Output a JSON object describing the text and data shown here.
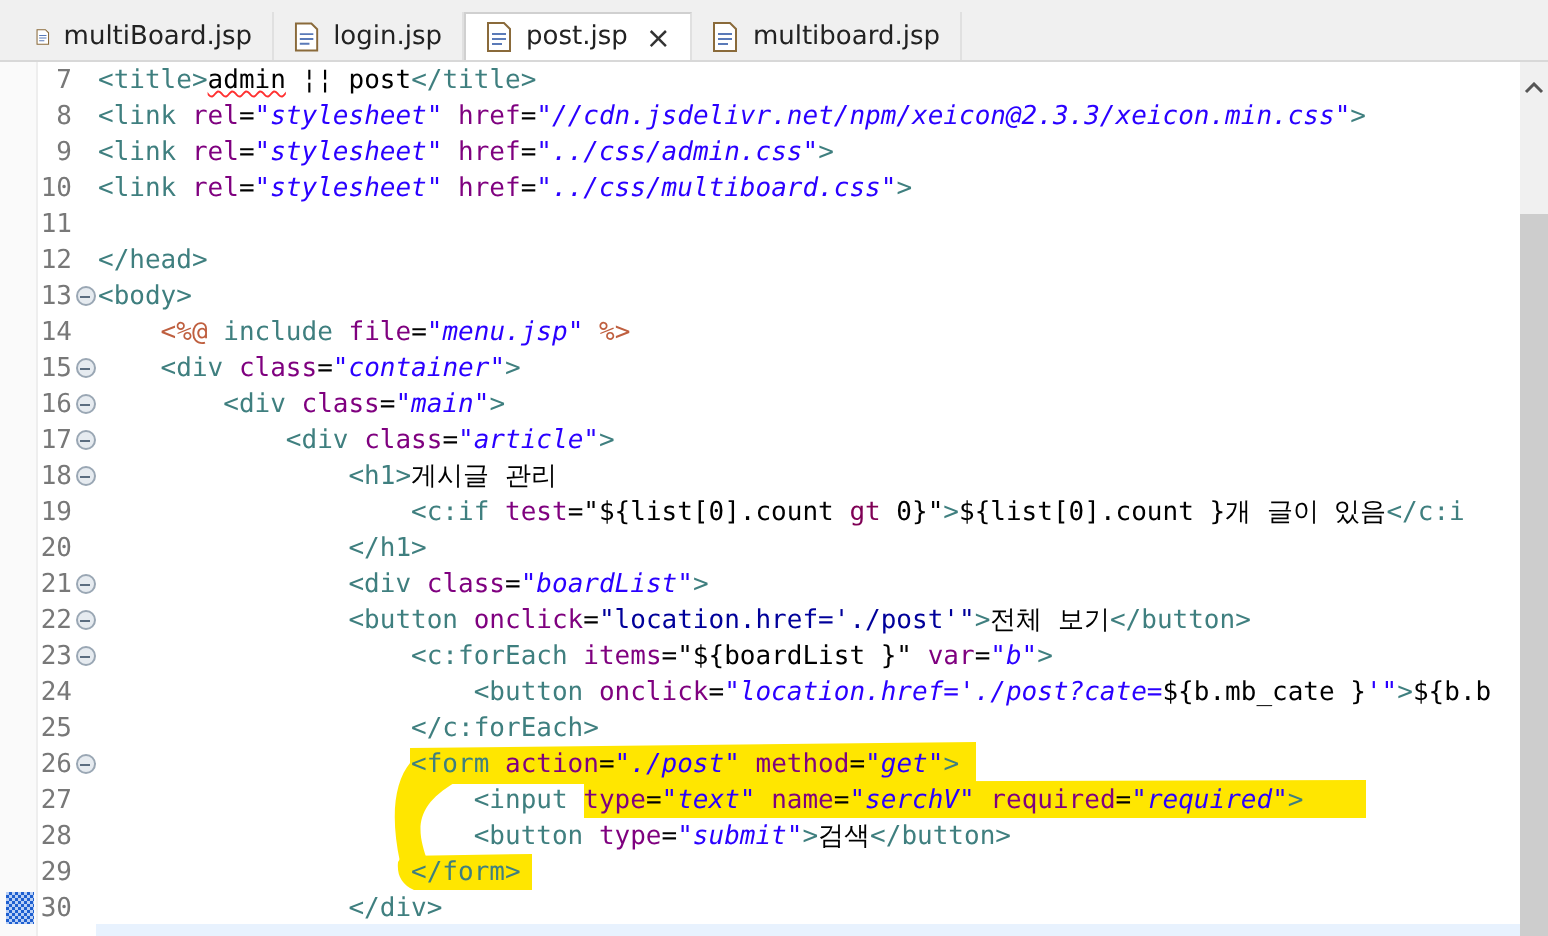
{
  "tabs": [
    {
      "label": "multiBoard.jsp",
      "selected": false
    },
    {
      "label": "login.jsp",
      "selected": false
    },
    {
      "label": "post.jsp",
      "selected": true,
      "close": "×"
    },
    {
      "label": "multiboard.jsp",
      "selected": false
    }
  ],
  "lines": [
    {
      "number": "7",
      "foldable": false,
      "changed": false,
      "tokens": [
        {
          "kind": "tag",
          "text": "<title>"
        },
        {
          "kind": "plain",
          "text": "admin",
          "spell_error": true
        },
        {
          "kind": "plain",
          "text": " ¦¦ post"
        },
        {
          "kind": "tag",
          "text": "</title>"
        }
      ]
    },
    {
      "number": "8",
      "foldable": false,
      "changed": false,
      "tokens": [
        {
          "kind": "tag",
          "text": "<link "
        },
        {
          "kind": "attr",
          "text": "rel"
        },
        {
          "kind": "plain",
          "text": "="
        },
        {
          "kind": "string",
          "text": "\"stylesheet\""
        },
        {
          "kind": "attr",
          "text": " href"
        },
        {
          "kind": "plain",
          "text": "="
        },
        {
          "kind": "string",
          "text": "\"//cdn.jsdelivr.net/npm/xeicon@2.3.3/xeicon.min.css\""
        },
        {
          "kind": "tag",
          "text": ">"
        }
      ]
    },
    {
      "number": "9",
      "foldable": false,
      "changed": false,
      "tokens": [
        {
          "kind": "tag",
          "text": "<link "
        },
        {
          "kind": "attr",
          "text": "rel"
        },
        {
          "kind": "plain",
          "text": "="
        },
        {
          "kind": "string",
          "text": "\"stylesheet\""
        },
        {
          "kind": "attr",
          "text": " href"
        },
        {
          "kind": "plain",
          "text": "="
        },
        {
          "kind": "string",
          "text": "\"../css/admin.css\""
        },
        {
          "kind": "tag",
          "text": ">"
        }
      ]
    },
    {
      "number": "10",
      "foldable": false,
      "changed": false,
      "tokens": [
        {
          "kind": "tag",
          "text": "<link "
        },
        {
          "kind": "attr",
          "text": "rel"
        },
        {
          "kind": "plain",
          "text": "="
        },
        {
          "kind": "string",
          "text": "\"stylesheet\""
        },
        {
          "kind": "attr",
          "text": " href"
        },
        {
          "kind": "plain",
          "text": "="
        },
        {
          "kind": "string",
          "text": "\"../css/multiboard.css\""
        },
        {
          "kind": "tag",
          "text": ">"
        }
      ]
    },
    {
      "number": "11",
      "foldable": false,
      "changed": false
    },
    {
      "number": "12",
      "foldable": false,
      "changed": false,
      "tokens": [
        {
          "kind": "tag",
          "text": "</head>"
        }
      ]
    },
    {
      "number": "13",
      "foldable": true,
      "changed": false,
      "tokens": [
        {
          "kind": "tag",
          "text": "<body>"
        }
      ]
    },
    {
      "number": "14",
      "foldable": false,
      "changed": false,
      "tokens": [
        {
          "kind": "jsp",
          "text": "    <%@ "
        },
        {
          "kind": "tag",
          "text": "include "
        },
        {
          "kind": "attr",
          "text": "file"
        },
        {
          "kind": "plain",
          "text": "="
        },
        {
          "kind": "string",
          "text": "\"menu.jsp\""
        },
        {
          "kind": "jsp",
          "text": " %>"
        }
      ]
    },
    {
      "number": "15",
      "foldable": true,
      "changed": false,
      "tokens": [
        {
          "kind": "tag",
          "text": "    <div "
        },
        {
          "kind": "attr",
          "text": "class"
        },
        {
          "kind": "plain",
          "text": "="
        },
        {
          "kind": "string",
          "text": "\"container\""
        },
        {
          "kind": "tag",
          "text": ">"
        }
      ]
    },
    {
      "number": "16",
      "foldable": true,
      "changed": false,
      "tokens": [
        {
          "kind": "tag",
          "text": "        <div "
        },
        {
          "kind": "attr",
          "text": "class"
        },
        {
          "kind": "plain",
          "text": "="
        },
        {
          "kind": "string",
          "text": "\"main\""
        },
        {
          "kind": "tag",
          "text": ">"
        }
      ]
    },
    {
      "number": "17",
      "foldable": true,
      "changed": false,
      "tokens": [
        {
          "kind": "tag",
          "text": "            <div "
        },
        {
          "kind": "attr",
          "text": "class"
        },
        {
          "kind": "plain",
          "text": "="
        },
        {
          "kind": "string",
          "text": "\"article\""
        },
        {
          "kind": "tag",
          "text": ">"
        }
      ]
    },
    {
      "number": "18",
      "foldable": true,
      "changed": false,
      "tokens": [
        {
          "kind": "tag",
          "text": "                <h1>"
        },
        {
          "kind": "plain",
          "text": "게시글 관리"
        }
      ]
    },
    {
      "number": "19",
      "foldable": false,
      "changed": false,
      "tokens": [
        {
          "kind": "tag",
          "text": "                    <c:if "
        },
        {
          "kind": "attr",
          "text": "test"
        },
        {
          "kind": "plain",
          "text": "=\"${list[0].count "
        },
        {
          "kind": "keyword",
          "text": "gt"
        },
        {
          "kind": "plain",
          "text": " 0}\""
        },
        {
          "kind": "tag",
          "text": ">"
        },
        {
          "kind": "plain",
          "text": "${list[0].count }개 글이 있음"
        },
        {
          "kind": "tag",
          "text": "</c:i"
        }
      ]
    },
    {
      "number": "20",
      "foldable": false,
      "changed": false,
      "tokens": [
        {
          "kind": "tag",
          "text": "                </h1>"
        }
      ]
    },
    {
      "number": "21",
      "foldable": true,
      "changed": false,
      "tokens": [
        {
          "kind": "tag",
          "text": "                <div "
        },
        {
          "kind": "attr",
          "text": "class"
        },
        {
          "kind": "plain",
          "text": "="
        },
        {
          "kind": "string",
          "text": "\"boardList\""
        },
        {
          "kind": "tag",
          "text": ">"
        }
      ]
    },
    {
      "number": "22",
      "foldable": true,
      "changed": false,
      "tokens": [
        {
          "kind": "tag",
          "text": "                <button "
        },
        {
          "kind": "attr",
          "text": "onclick"
        },
        {
          "kind": "plain",
          "text": "="
        },
        {
          "kind": "script",
          "text": "\"location.href='./post'\""
        },
        {
          "kind": "tag",
          "text": ">"
        },
        {
          "kind": "plain",
          "text": "전체 보기"
        },
        {
          "kind": "tag",
          "text": "</button>"
        }
      ]
    },
    {
      "number": "23",
      "foldable": true,
      "changed": false,
      "tokens": [
        {
          "kind": "tag",
          "text": "                    <c:forEach "
        },
        {
          "kind": "attr",
          "text": "items"
        },
        {
          "kind": "plain",
          "text": "=\"${boardList }\" "
        },
        {
          "kind": "attr",
          "text": "var"
        },
        {
          "kind": "plain",
          "text": "="
        },
        {
          "kind": "string",
          "text": "\"b\""
        },
        {
          "kind": "tag",
          "text": ">"
        }
      ]
    },
    {
      "number": "24",
      "foldable": false,
      "changed": false,
      "tokens": [
        {
          "kind": "tag",
          "text": "                        <button "
        },
        {
          "kind": "attr",
          "text": "onclick"
        },
        {
          "kind": "plain",
          "text": "="
        },
        {
          "kind": "string",
          "text": "\"location.href='./post?cate="
        },
        {
          "kind": "plain",
          "text": "${b.mb_cate }"
        },
        {
          "kind": "string",
          "text": "'\""
        },
        {
          "kind": "tag",
          "text": ">"
        },
        {
          "kind": "plain",
          "text": "${b.b"
        }
      ]
    },
    {
      "number": "25",
      "foldable": false,
      "changed": false,
      "tokens": [
        {
          "kind": "tag",
          "text": "                    </c:forEach>"
        }
      ]
    },
    {
      "number": "26",
      "foldable": true,
      "changed": false,
      "tokens": [
        {
          "kind": "tag",
          "text": "                    <form "
        },
        {
          "kind": "attr",
          "text": "action"
        },
        {
          "kind": "plain",
          "text": "="
        },
        {
          "kind": "string",
          "text": "\"./post\""
        },
        {
          "kind": "attr",
          "text": " method"
        },
        {
          "kind": "plain",
          "text": "="
        },
        {
          "kind": "string",
          "text": "\"get\""
        },
        {
          "kind": "tag",
          "text": ">"
        }
      ]
    },
    {
      "number": "27",
      "foldable": false,
      "changed": false,
      "tokens": [
        {
          "kind": "tag",
          "text": "                        <input "
        },
        {
          "kind": "attr",
          "text": "type"
        },
        {
          "kind": "plain",
          "text": "="
        },
        {
          "kind": "string",
          "text": "\"text\""
        },
        {
          "kind": "attr",
          "text": " name"
        },
        {
          "kind": "plain",
          "text": "="
        },
        {
          "kind": "string",
          "text": "\"serchV\""
        },
        {
          "kind": "attr",
          "text": " required"
        },
        {
          "kind": "plain",
          "text": "="
        },
        {
          "kind": "string",
          "text": "\"required\""
        },
        {
          "kind": "tag",
          "text": ">"
        }
      ]
    },
    {
      "number": "28",
      "foldable": false,
      "changed": false,
      "tokens": [
        {
          "kind": "tag",
          "text": "                        <button "
        },
        {
          "kind": "attr",
          "text": "type"
        },
        {
          "kind": "plain",
          "text": "="
        },
        {
          "kind": "string",
          "text": "\"submit\""
        },
        {
          "kind": "tag",
          "text": ">"
        },
        {
          "kind": "plain",
          "text": "검색"
        },
        {
          "kind": "tag",
          "text": "</button>"
        }
      ]
    },
    {
      "number": "29",
      "foldable": false,
      "changed": false,
      "tokens": [
        {
          "kind": "tag",
          "text": "                    </form>"
        }
      ]
    },
    {
      "number": "30",
      "foldable": false,
      "changed": true,
      "tokens": [
        {
          "kind": "tag",
          "text": "                </div>"
        }
      ]
    }
  ]
}
